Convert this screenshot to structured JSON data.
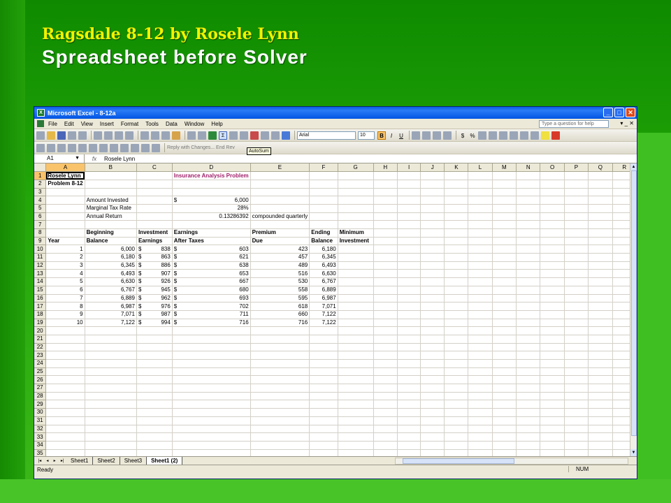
{
  "slide": {
    "title": "Ragsdale 8-12 by Rosele Lynn",
    "subtitle": "Spreadsheet before Solver"
  },
  "window": {
    "title": "Microsoft Excel - 8-12a",
    "min_glyph": "_",
    "max_glyph": "□",
    "close_glyph": "✕"
  },
  "menu": {
    "items": [
      "File",
      "Edit",
      "View",
      "Insert",
      "Format",
      "Tools",
      "Data",
      "Window",
      "Help"
    ],
    "help_placeholder": "Type a question for help",
    "window_ctrls": "▾ _ ✕"
  },
  "toolbar": {
    "font_name": "Arial",
    "font_size": "10",
    "bold": "B",
    "italic": "I",
    "underline": "U",
    "currency": "$",
    "percent": "%",
    "autosum_glyph": "Σ",
    "tooltip": "AutoSum",
    "reviewing_text": "Reply with Changes...   End Rev"
  },
  "formula_bar": {
    "cell_ref": "A1",
    "fx": "fx",
    "value": "Rosele Lynn"
  },
  "grid": {
    "columns": [
      "A",
      "B",
      "C",
      "D",
      "E",
      "F",
      "G",
      "H",
      "I",
      "J",
      "K",
      "L",
      "M",
      "N",
      "O",
      "P",
      "Q",
      "R"
    ],
    "selected_col": "A",
    "selected_row": "1",
    "rows": [
      {
        "n": "1",
        "A": "Rosele Lynn",
        "D": "Insurance Analysis Problem"
      },
      {
        "n": "2",
        "A": "Problem 8-12"
      },
      {
        "n": "3"
      },
      {
        "n": "4",
        "B": "Amount Invested",
        "D1": "$",
        "D": "6,000"
      },
      {
        "n": "5",
        "B": "Marginal Tax Rate",
        "D": "28%"
      },
      {
        "n": "6",
        "B": "Annual Return",
        "D": "0.13286392",
        "E": "compounded quarterly"
      },
      {
        "n": "7"
      },
      {
        "n": "8",
        "B": "Beginning",
        "C": "Investment",
        "D": "Earnings",
        "E": "Premium",
        "F": "Ending",
        "G": "Minimum"
      },
      {
        "n": "9",
        "A": "Year",
        "B": "Balance",
        "C": "Earnings",
        "D": "After Taxes",
        "E": "Due",
        "F": "Balance",
        "G": "Investment"
      },
      {
        "n": "10",
        "A": "1",
        "B": "6,000",
        "C1": "$",
        "C": "838",
        "D1": "$",
        "D": "603",
        "E": "423",
        "F": "6,180"
      },
      {
        "n": "11",
        "A": "2",
        "B": "6,180",
        "C1": "$",
        "C": "863",
        "D1": "$",
        "D": "621",
        "E": "457",
        "F": "6,345"
      },
      {
        "n": "12",
        "A": "3",
        "B": "6,345",
        "C1": "$",
        "C": "886",
        "D1": "$",
        "D": "638",
        "E": "489",
        "F": "6,493"
      },
      {
        "n": "13",
        "A": "4",
        "B": "6,493",
        "C1": "$",
        "C": "907",
        "D1": "$",
        "D": "653",
        "E": "516",
        "F": "6,630"
      },
      {
        "n": "14",
        "A": "5",
        "B": "6,630",
        "C1": "$",
        "C": "926",
        "D1": "$",
        "D": "667",
        "E": "530",
        "F": "6,767"
      },
      {
        "n": "15",
        "A": "6",
        "B": "6,767",
        "C1": "$",
        "C": "945",
        "D1": "$",
        "D": "680",
        "E": "558",
        "F": "6,889"
      },
      {
        "n": "16",
        "A": "7",
        "B": "6,889",
        "C1": "$",
        "C": "962",
        "D1": "$",
        "D": "693",
        "E": "595",
        "F": "6,987"
      },
      {
        "n": "17",
        "A": "8",
        "B": "6,987",
        "C1": "$",
        "C": "976",
        "D1": "$",
        "D": "702",
        "E": "618",
        "F": "7,071"
      },
      {
        "n": "18",
        "A": "9",
        "B": "7,071",
        "C1": "$",
        "C": "987",
        "D1": "$",
        "D": "711",
        "E": "660",
        "F": "7,122"
      },
      {
        "n": "19",
        "A": "10",
        "B": "7,122",
        "C1": "$",
        "C": "994",
        "D1": "$",
        "D": "716",
        "E": "716",
        "F": "7,122"
      },
      {
        "n": "20"
      },
      {
        "n": "21"
      },
      {
        "n": "22"
      },
      {
        "n": "23"
      },
      {
        "n": "24"
      },
      {
        "n": "25"
      },
      {
        "n": "26"
      },
      {
        "n": "27"
      },
      {
        "n": "28"
      },
      {
        "n": "29"
      },
      {
        "n": "30"
      },
      {
        "n": "31"
      },
      {
        "n": "32"
      },
      {
        "n": "33"
      },
      {
        "n": "34"
      },
      {
        "n": "35"
      }
    ]
  },
  "tabs": {
    "nav": [
      "|◂",
      "◂",
      "▸",
      "▸|"
    ],
    "sheets": [
      "Sheet1",
      "Sheet2",
      "Sheet3",
      "Sheet1 (2)"
    ],
    "active": "Sheet1 (2)"
  },
  "status": {
    "ready": "Ready",
    "num": "NUM"
  }
}
